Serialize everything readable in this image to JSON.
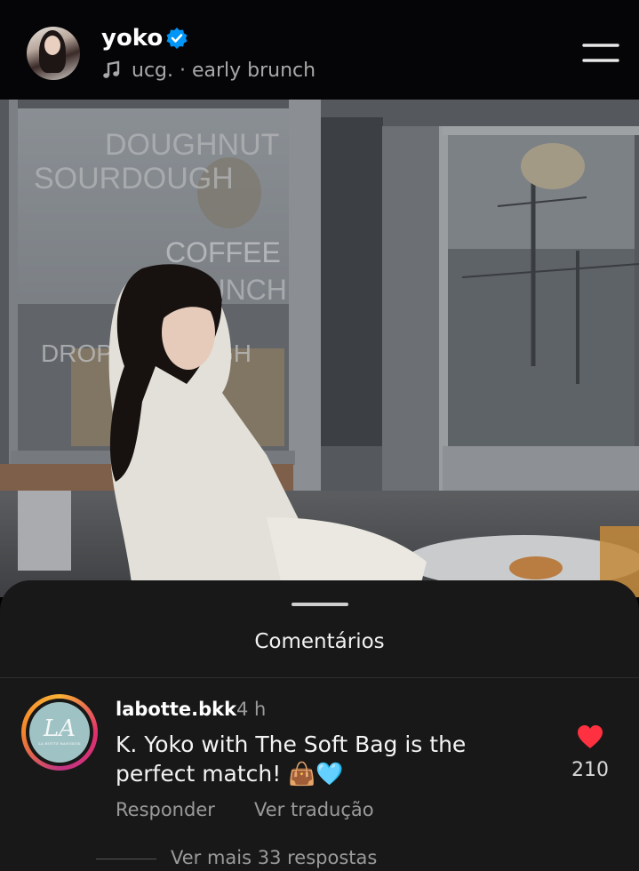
{
  "header": {
    "username": "yoko",
    "music_line": "ucg. · early brunch"
  },
  "photo": {
    "sign_lines": [
      "DOUGHNUT",
      "SOURDOUGH",
      "COFFEE",
      "BRUNCH",
      "DROP BY DOUGH"
    ]
  },
  "comments_sheet": {
    "title": "Comentários",
    "comment": {
      "username": "labotte.bkk",
      "time": "4 h",
      "avatar_logo_text": "LA",
      "text": "K. Yoko with The Soft Bag is the perfect match! 👜🩵",
      "likes": "210",
      "reply_label": "Responder",
      "translate_label": "Ver tradução",
      "more_replies": "Ver mais 33 respostas"
    }
  },
  "colors": {
    "verified": "#0095f6",
    "like": "#ff3040",
    "sheet_bg": "#181818"
  }
}
